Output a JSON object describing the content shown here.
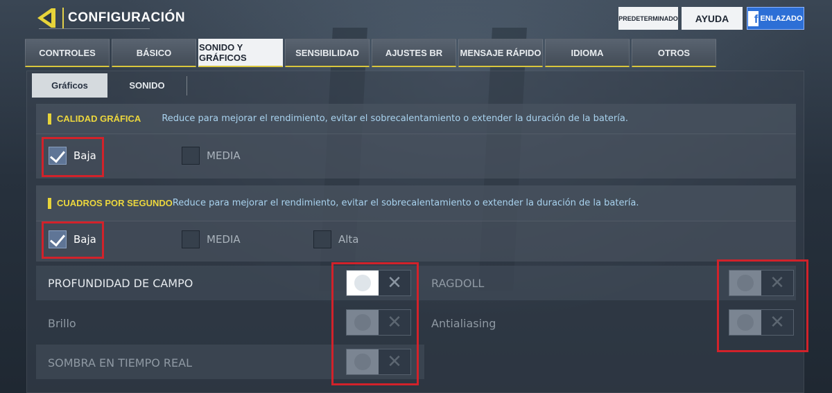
{
  "header": {
    "back_title": "CONFIGURACIÓN",
    "btn_default": "PREDETERMINADO",
    "btn_help": "AYUDA",
    "btn_facebook": "ENLAZADO",
    "facebook_logo": "f"
  },
  "tabs": [
    {
      "label": "CONTROLES"
    },
    {
      "label": "BÁSICO"
    },
    {
      "label": "SONIDO Y GRÁFICOS"
    },
    {
      "label": "SENSIBILIDAD"
    },
    {
      "label": "AJUSTES BR"
    },
    {
      "label": "MENSAJE RÁPIDO"
    },
    {
      "label": "IDIOMA"
    },
    {
      "label": "OTROS"
    }
  ],
  "subtabs": [
    {
      "label": "Gráficos"
    },
    {
      "label": "SONIDO"
    }
  ],
  "quality": {
    "title": "CALIDAD GRÁFICA",
    "desc": "Reduce para mejorar el rendimiento, evitar el sobrecalentamiento o extender la duración de la batería.",
    "options": [
      {
        "label": "Baja",
        "checked": true
      },
      {
        "label": "MEDIA",
        "checked": false
      }
    ]
  },
  "fps": {
    "title": "CUADROS POR SEGUNDO",
    "desc": "Reduce para mejorar el rendimiento, evitar el sobrecalentamiento o extender la duración de la batería.",
    "options": [
      {
        "label": "Baja",
        "checked": true
      },
      {
        "label": "MEDIA",
        "checked": false
      },
      {
        "label": "Alta",
        "checked": false
      }
    ]
  },
  "toggles": {
    "depth_of_field": "PROFUNDIDAD DE CAMPO",
    "brightness": "Brillo",
    "realtime_shadow": "SOMBRA EN TIEMPO REAL",
    "ragdoll": "RAGDOLL",
    "antialiasing": "Antialiasing",
    "x_symbol": "✕"
  },
  "colors": {
    "accent_yellow": "#e7d43a",
    "highlight_red": "#d2222a",
    "facebook_blue": "#2d6fd6"
  }
}
